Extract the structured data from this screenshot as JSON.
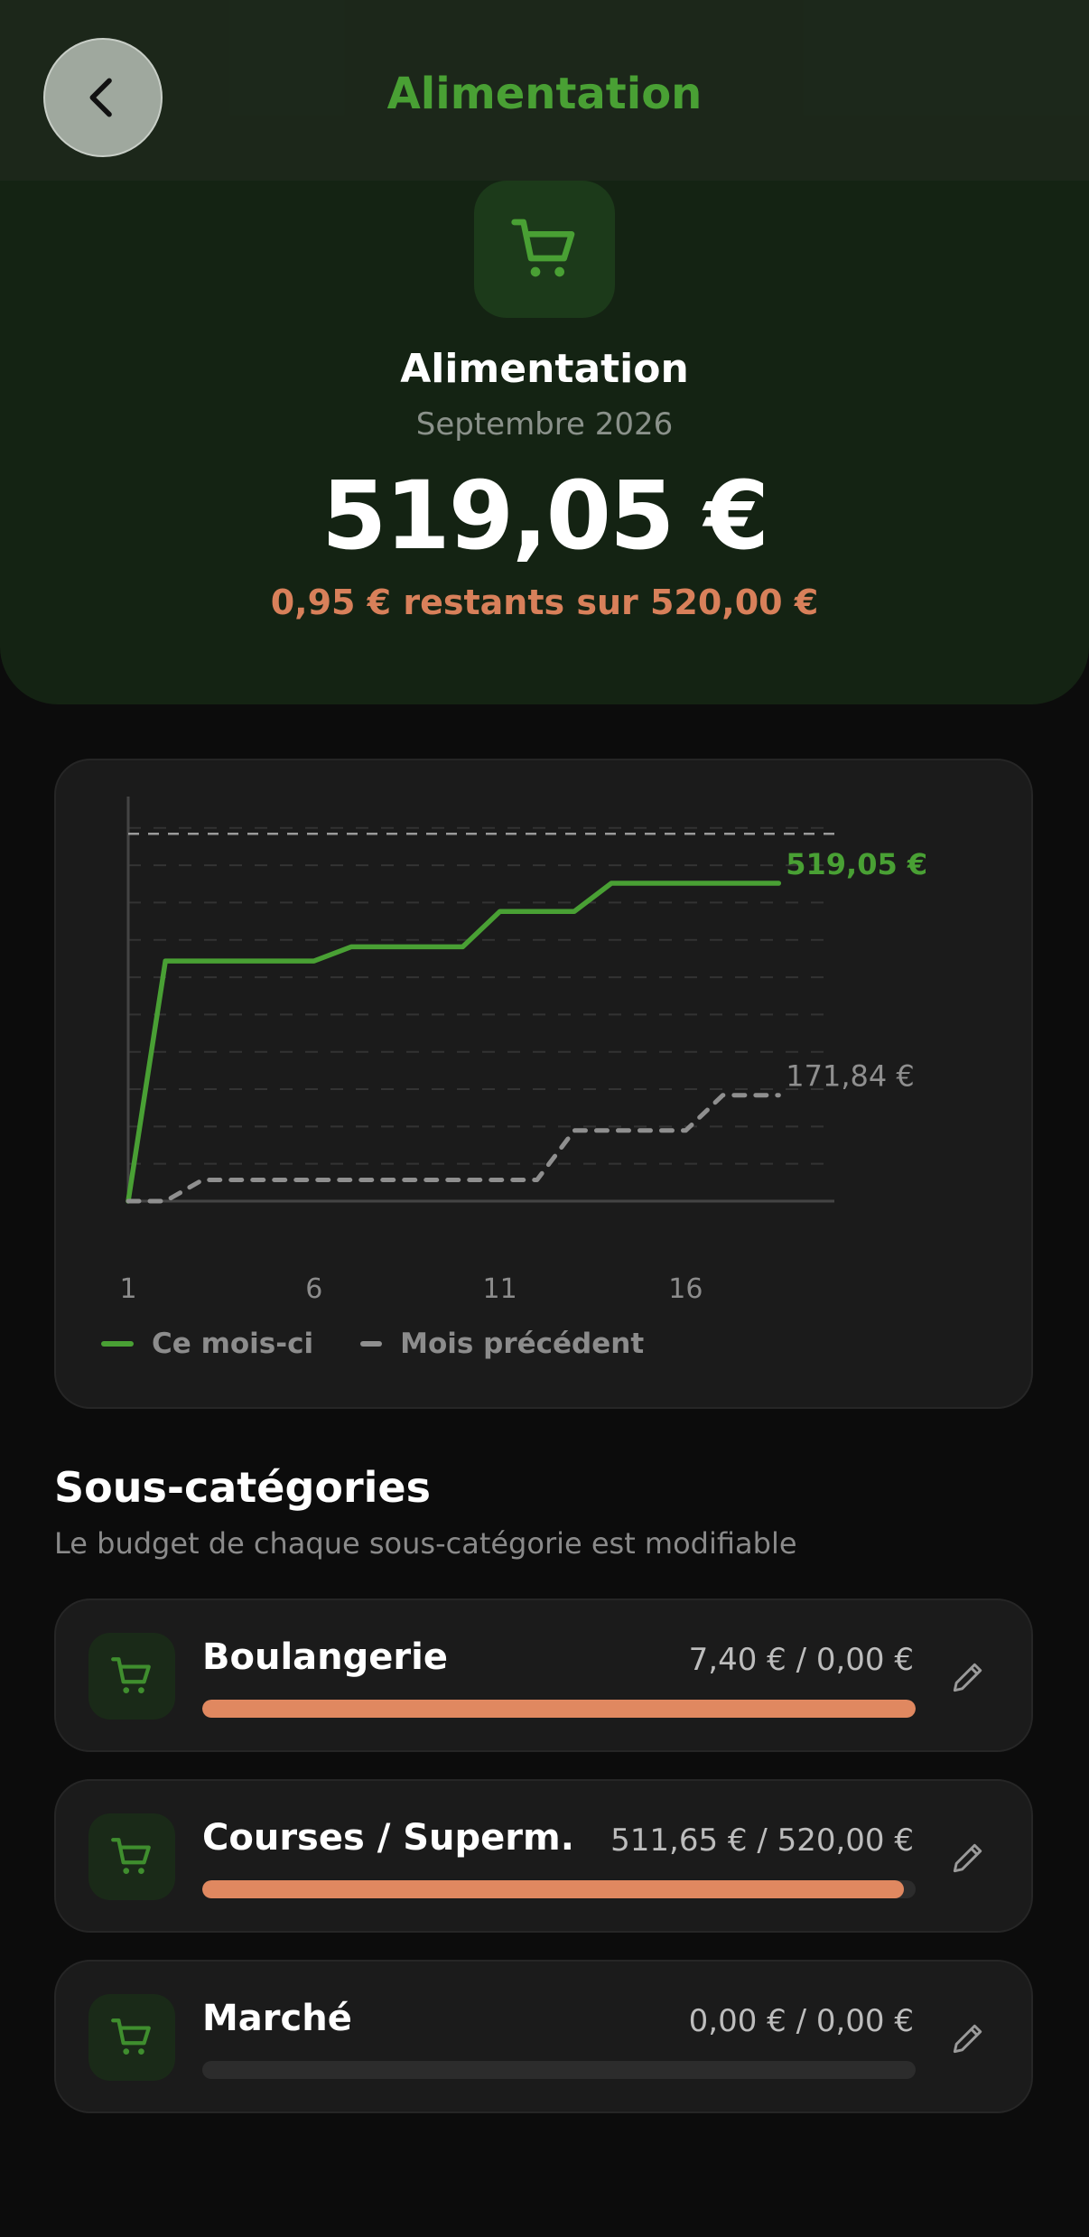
{
  "header": {
    "title": "Alimentation",
    "back_icon": "chevron-left-icon"
  },
  "category": {
    "icon": "shopping-cart-icon",
    "name": "Alimentation",
    "period": "Septembre 2026",
    "amount": "519,05 €",
    "remaining": "0,95 € restants sur 520,00 €"
  },
  "colors": {
    "accent": "#49a034",
    "warning": "#e08860",
    "previous": "#8f8f8f"
  },
  "chart_data": {
    "type": "line",
    "xlabel": "",
    "ylabel": "",
    "x_ticks": [
      "1",
      "6",
      "11",
      "16"
    ],
    "xlim": [
      1,
      20
    ],
    "ylim": [
      0,
      560
    ],
    "budget_line": 520,
    "series": [
      {
        "name": "Ce mois-ci",
        "end_label": "519,05 €",
        "color": "#49a034",
        "points": [
          [
            1,
            0
          ],
          [
            2,
            340
          ],
          [
            6,
            340
          ],
          [
            7,
            360
          ],
          [
            10,
            360
          ],
          [
            11,
            410
          ],
          [
            13,
            410
          ],
          [
            14,
            450
          ],
          [
            18.5,
            450
          ]
        ]
      },
      {
        "name": "Mois précédent",
        "end_label": "171,84 €",
        "color": "#8f8f8f",
        "dashed": true,
        "points": [
          [
            1,
            0
          ],
          [
            2,
            0
          ],
          [
            3,
            30
          ],
          [
            12,
            30
          ],
          [
            13,
            100
          ],
          [
            16,
            100
          ],
          [
            17,
            150
          ],
          [
            18.5,
            150
          ]
        ]
      }
    ]
  },
  "subcategories": {
    "title": "Sous-catégories",
    "subtitle": "Le budget de chaque sous-catégorie est modifiable",
    "items": [
      {
        "name": "Boulangerie",
        "amount": "7,40 € / 0,00 €",
        "progress": 1.0,
        "icon": "shopping-cart-icon",
        "edit_icon": "pencil-icon"
      },
      {
        "name": "Courses / Superm...",
        "amount": "511,65 € / 520,00 €",
        "progress": 0.984,
        "icon": "shopping-cart-icon",
        "edit_icon": "pencil-icon"
      },
      {
        "name": "Marché",
        "amount": "0,00 € / 0,00 €",
        "progress": 0.0,
        "icon": "shopping-cart-icon",
        "edit_icon": "pencil-icon"
      }
    ]
  }
}
